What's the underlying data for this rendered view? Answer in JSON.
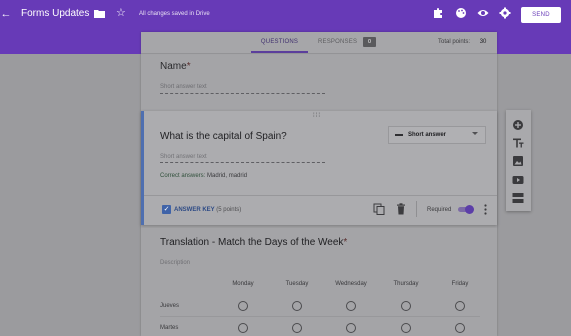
{
  "header": {
    "back_icon": "arrow-left-icon",
    "title": "Forms Updates",
    "saved_status": "All changes saved in Drive",
    "send_label": "SEND",
    "icons": [
      "puzzle-icon",
      "palette-icon",
      "eye-icon",
      "gear-icon"
    ],
    "accent_color": "#673ab7"
  },
  "tabs": {
    "questions_label": "QUESTIONS",
    "responses_label": "RESPONSES",
    "responses_count": "0",
    "total_points_label": "Total points:",
    "total_points_value": "30"
  },
  "question1": {
    "title": "Name",
    "required_mark": "*",
    "placeholder": "Short answer text"
  },
  "question2": {
    "title": "What is the capital of Spain?",
    "type_label": "Short answer",
    "placeholder": "Short answer text",
    "correct_label": "Correct answers:",
    "correct_values": "Madrid, madrid",
    "answer_key_label": "ANSWER KEY",
    "answer_key_points": "(5 points)",
    "required_label": "Required",
    "required_on": true
  },
  "question3": {
    "title": "Translation - Match the Days of the Week",
    "required_mark": "*",
    "description_placeholder": "Description",
    "columns": [
      "Monday",
      "Tuesday",
      "Wednesday",
      "Thursday",
      "Friday"
    ],
    "rows": [
      "Jueves",
      "Martes"
    ]
  },
  "side_toolbar": [
    "add-circle-icon",
    "title-text-icon",
    "image-icon",
    "video-icon",
    "section-icon"
  ]
}
